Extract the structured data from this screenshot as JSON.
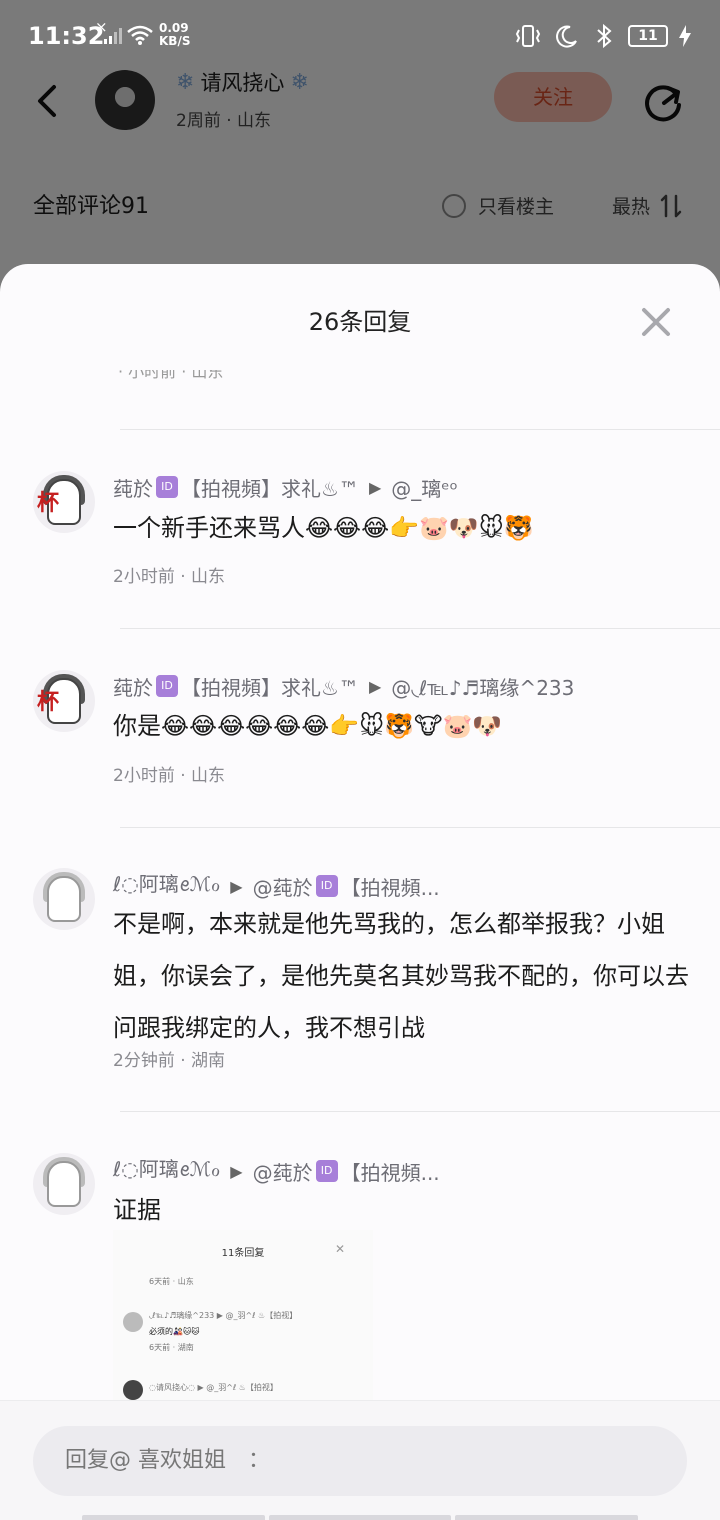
{
  "status_bar": {
    "time": "11:32",
    "net_x": "×",
    "net_speed_value": "0.09",
    "net_speed_unit": "KB/S",
    "battery": "11"
  },
  "post": {
    "author_name": "请风挠心",
    "author_meta": "2周前 · 山东",
    "follow_label": "关注"
  },
  "comments_bar": {
    "total": "全部评论91",
    "only_author": "只看楼主",
    "sort": "最热"
  },
  "sheet": {
    "title": "26条回复",
    "partial_meta": "· 小时前 · 山东"
  },
  "replies": [
    {
      "user": "莼於",
      "user_tail": "【拍視頻】求礼♨™",
      "target": "@_璃ᵉᵒ",
      "text": "一个新手还来骂人😂😂😂👉🐷🐶🐭🐯",
      "meta": "2小时前 · 山东"
    },
    {
      "user": "莼於",
      "user_tail": "【拍視頻】求礼♨™",
      "target": "@◟ℓ℡♪♬璃缘^233",
      "text": "你是😂😂😂😂😂😂👉🐭🐯🐮🐷🐶",
      "meta": "2小时前 · 山东"
    },
    {
      "user": "ℓ◌阿璃ꫀℳℴ",
      "target": "@莼於",
      "target_tail": "【拍視頻...",
      "text": "不是啊，本来就是他先骂我的，怎么都举报我？小姐姐，你误会了，是他先莫名其妙骂我不配的，你可以去问跟我绑定的人，我不想引战",
      "meta": "2分钟前 · 湖南"
    },
    {
      "user": "ℓ◌阿璃ꫀℳℴ",
      "target": "@莼於",
      "target_tail": "【拍視頻...",
      "text": "证据"
    }
  ],
  "embed": {
    "title": "11条回复",
    "line1": "6天前 · 山东",
    "line2": "◟ℓ℡♪♬璃缘^233 ▶ @_羽^ℓ ♨【拍视】",
    "line3": "必须的🎎🐱🐱",
    "line4": "6天前 · 湖南",
    "line5": "◌请风挠心◌ ▶ @_羽^ℓ ♨【拍视】"
  },
  "input": {
    "placeholder": "回复@ 喜欢姐姐　："
  },
  "colors": {
    "accent_follow_bg": "#f4b6a8",
    "accent_follow_text": "#d34a2a",
    "id_badge": "#a77fd9"
  }
}
